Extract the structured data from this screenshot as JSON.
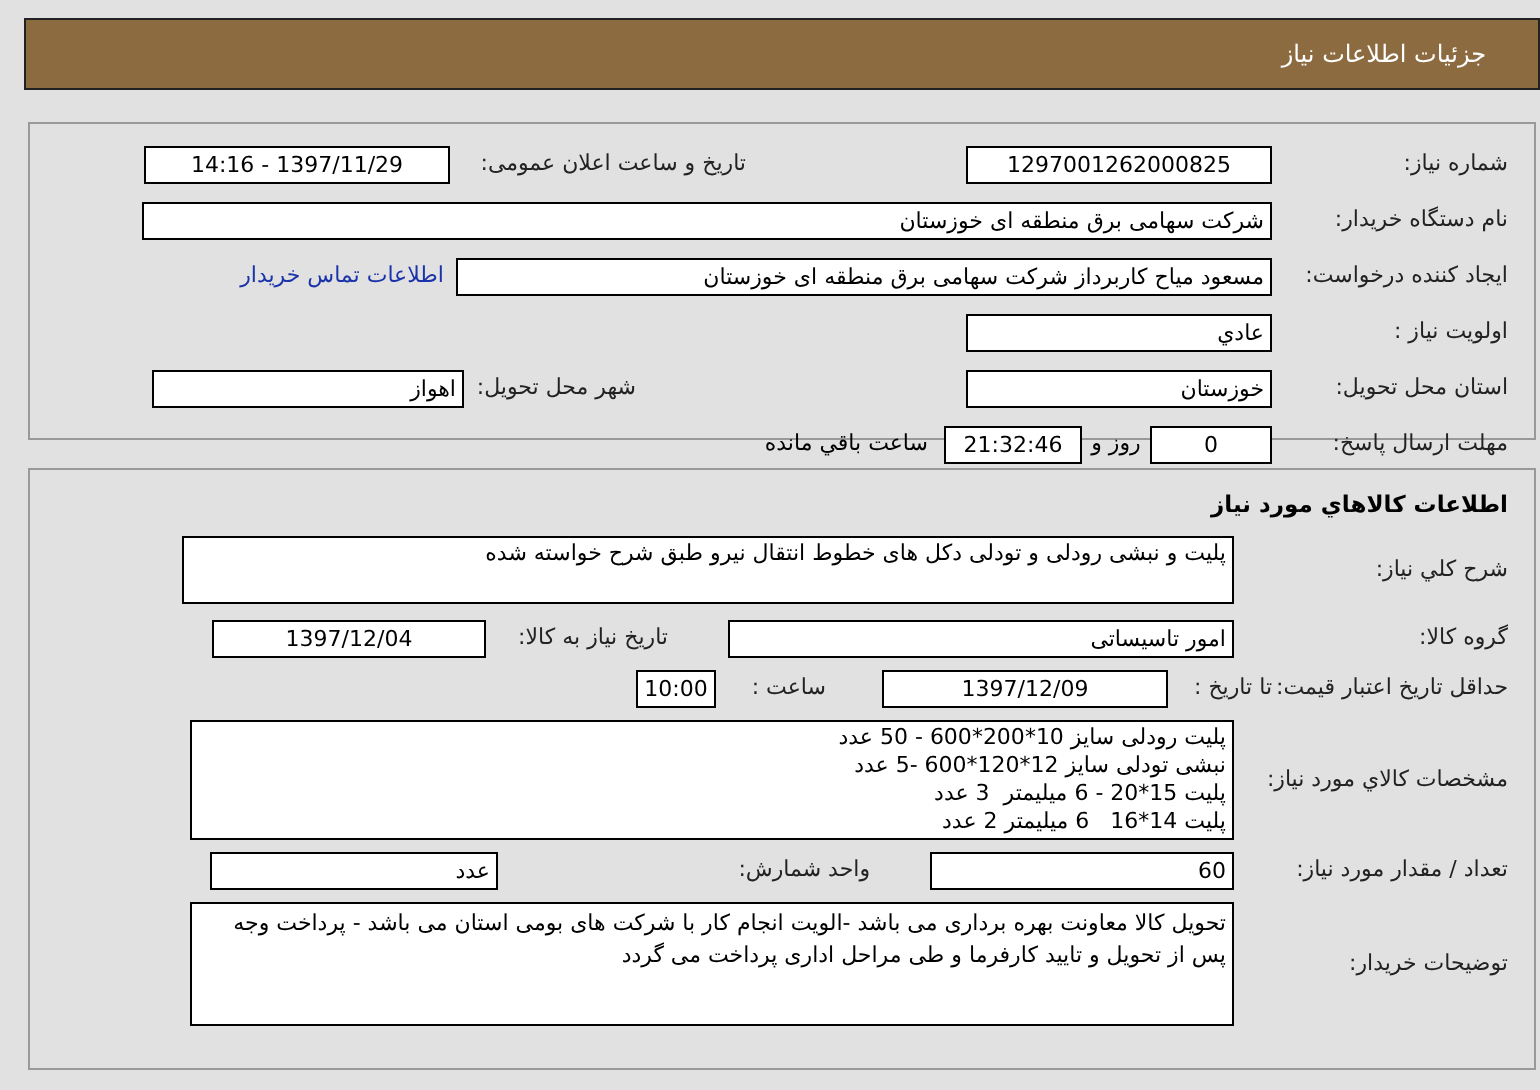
{
  "header": {
    "title": "جزئیات اطلاعات نیاز"
  },
  "request": {
    "need_number_label": "شماره نیاز:",
    "need_number": "1297001262000825",
    "announce_label": "تاریخ و ساعت اعلان عمومی:",
    "announce_value": "1397/11/29 - 14:16",
    "buyer_label": "نام دستگاه خریدار:",
    "buyer": "شرکت سهامی برق منطقه ای خوزستان",
    "creator_label": "ایجاد کننده درخواست:",
    "creator": "مسعود میاح کاربرداز شرکت سهامی برق منطقه ای خوزستان",
    "contact_link": "اطلاعات تماس خریدار",
    "priority_label": "اولویت نیاز :",
    "priority": "عادي",
    "province_label": "استان محل تحویل:",
    "province": "خوزستان",
    "city_label": "شهر محل تحویل:",
    "city": "اهواز",
    "deadline_label": "مهلت ارسال پاسخ:",
    "days": "0",
    "days_suffix": "روز و",
    "time": "21:32:46",
    "time_suffix": "ساعت باقي مانده"
  },
  "goods": {
    "title": "اطلاعات کالاهاي مورد نیاز",
    "summary_label": "شرح کلي نیاز:",
    "summary": "پلیت و نبشی رودلی و تودلی دکل های خطوط انتقال نیرو طبق شرح خواسته شده",
    "group_label": "گروه کالا:",
    "group": "امور تاسیساتی",
    "need_date_label": "تاریخ نیاز به کالا:",
    "need_date": "1397/12/04",
    "validity_label": "حداقل تاریخ اعتبار قیمت:",
    "until_label": "تا تاریخ :",
    "until_date": "1397/12/09",
    "hour_label": "ساعت :",
    "hour": "10:00",
    "specs_label": "مشخصات کالاي مورد نیاز:",
    "specs": [
      "پلیت رودلی سایز 10*200*600 - 50 عدد",
      "نبشی تودلی سایز 12*120*600 -5 عدد",
      "پلیت 15*20 - 6 میلیمتر  3 عدد",
      "پلیت 14*16   6 میلیمتر 2 عدد"
    ],
    "quantity_label": "تعداد / مقدار مورد نیاز:",
    "quantity": "60",
    "unit_label": "واحد شمارش:",
    "unit": "عدد",
    "notes_label": "توضیحات خریدار:",
    "notes": "تحویل کالا معاونت بهره برداری می باشد -الویت انجام کار با شرکت های بومی استان می باشد - پرداخت وجه پس از تحویل و تایید کارفرما و طی مراحل اداری پرداخت می گردد"
  }
}
